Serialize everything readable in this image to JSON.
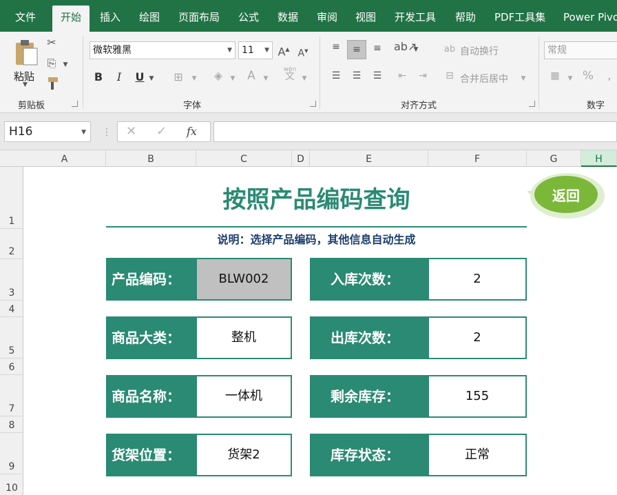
{
  "menu": {
    "tabs": [
      "文件",
      "开始",
      "插入",
      "绘图",
      "页面布局",
      "公式",
      "数据",
      "审阅",
      "视图",
      "开发工具",
      "帮助",
      "PDF工具集",
      "Power Pivo"
    ],
    "active": "开始"
  },
  "ribbon": {
    "clipboard": {
      "label": "剪贴板",
      "paste_label": "粘贴"
    },
    "font": {
      "label": "字体",
      "font_name": "微软雅黑",
      "font_size": "11",
      "bold": "B",
      "italic": "I",
      "underline": "U",
      "wen_small": "wén",
      "wen_big": "文"
    },
    "alignment": {
      "label": "对齐方式",
      "wrap_text": "自动换行",
      "merge_center": "合并后居中"
    },
    "number": {
      "label": "数字",
      "format": "常规",
      "percent": "%"
    }
  },
  "formula_bar": {
    "name_box": "H16",
    "fx": "fx",
    "value": ""
  },
  "grid": {
    "columns": [
      "A",
      "B",
      "C",
      "D",
      "E",
      "F",
      "G",
      "H"
    ],
    "selected_column": "H",
    "rows": [
      "1",
      "2",
      "3",
      "4",
      "5",
      "6",
      "7",
      "8",
      "9",
      "10"
    ]
  },
  "sheet": {
    "title": "按照产品编码查询",
    "subtitle": "说明：选择产品编码，其他信息自动生成",
    "return_button": "返回",
    "fields_left": [
      {
        "label": "产品编码：",
        "value": "BLW002"
      },
      {
        "label": "商品大类：",
        "value": "整机"
      },
      {
        "label": "商品名称：",
        "value": "一体机"
      },
      {
        "label": "货架位置：",
        "value": "货架2"
      }
    ],
    "fields_right": [
      {
        "label": "入库次数：",
        "value": "2"
      },
      {
        "label": "出库次数：",
        "value": "2"
      },
      {
        "label": "剩余库存：",
        "value": "155"
      },
      {
        "label": "库存状态：",
        "value": "正常"
      }
    ]
  },
  "colors": {
    "excel_green": "#217346",
    "accent_teal": "#2a8a73",
    "subtitle_navy": "#1d3e6e",
    "input_gray": "#c0c0c0",
    "return_green": "#7bb83a"
  }
}
